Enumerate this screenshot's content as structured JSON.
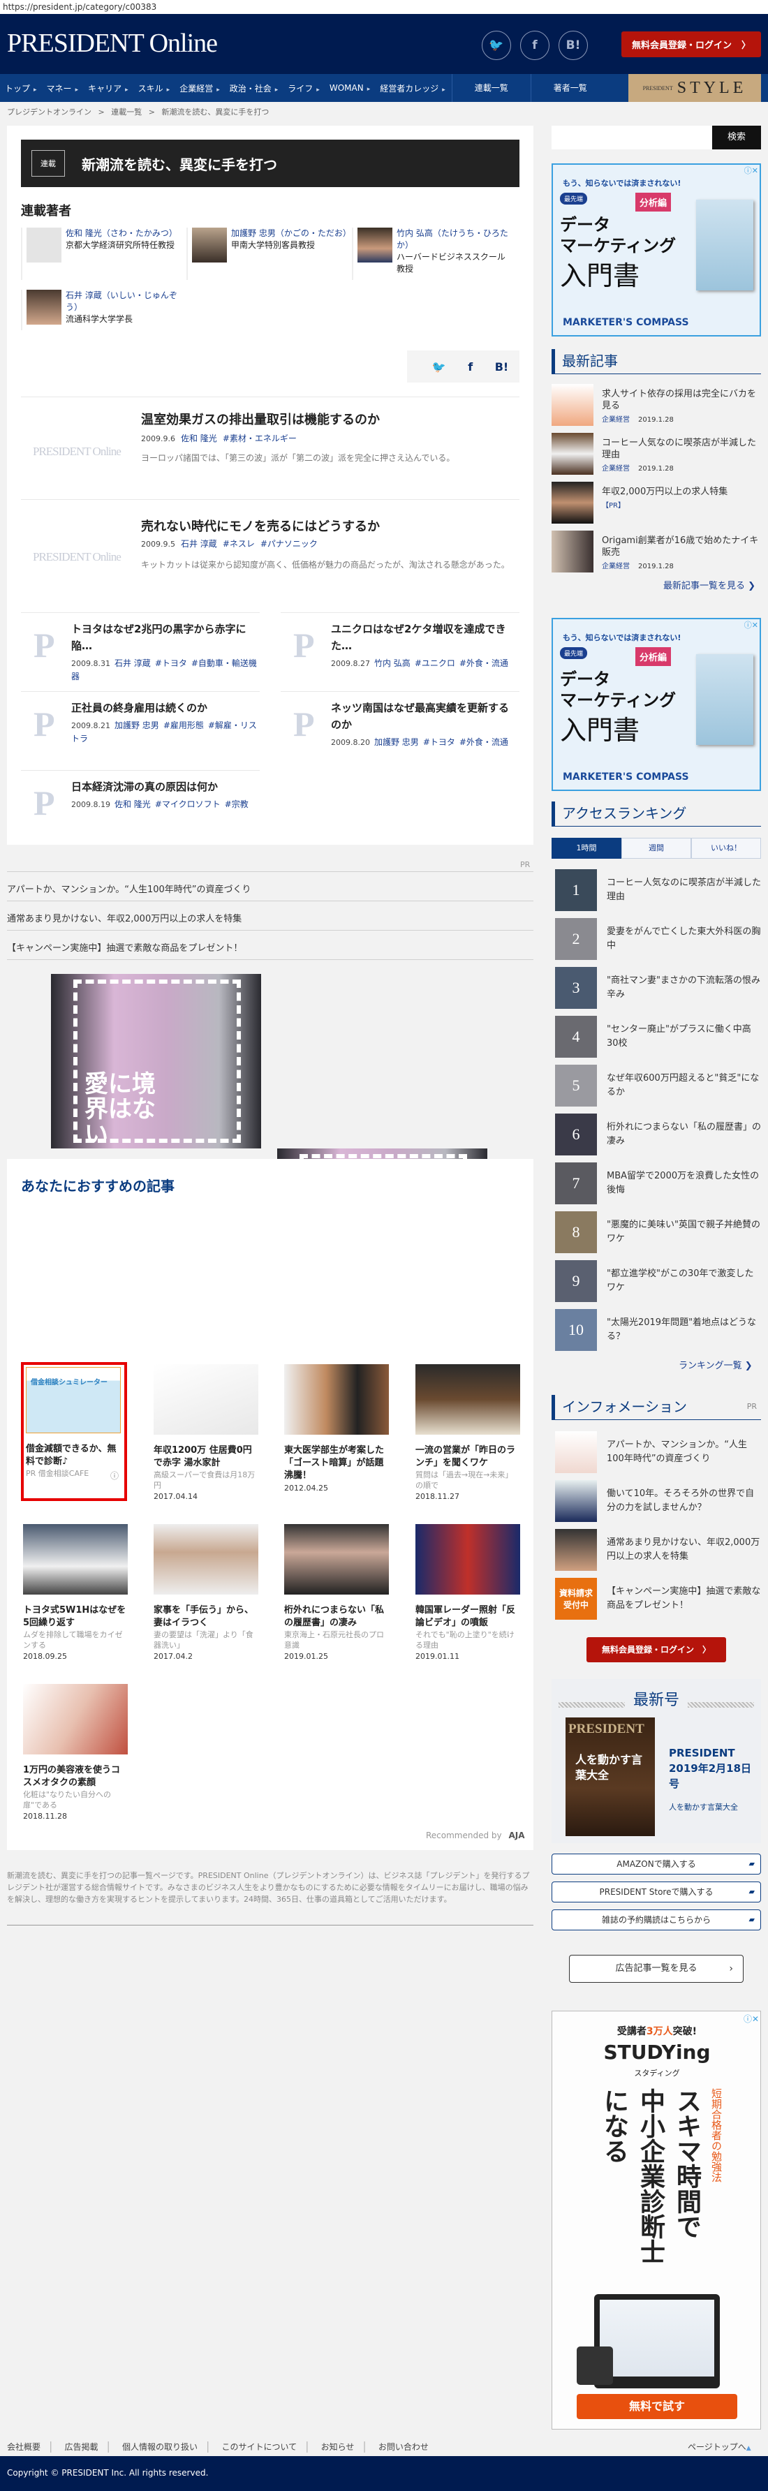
{
  "url": "https://president.jp/category/c00383",
  "header": {
    "logo": "PRESIDENT Online",
    "social": [
      "twitter",
      "facebook",
      "hatena"
    ],
    "social_labels": {
      "twitter": "🐦",
      "facebook": "f",
      "hatena": "B!"
    },
    "login": "無料会員登録・ログイン",
    "login_arrow": "〉"
  },
  "nav": {
    "items": [
      "トップ",
      "マネー",
      "キャリア",
      "スキル",
      "企業経営",
      "政治・社会",
      "ライフ",
      "WOMAN",
      "経営者カレッジ"
    ],
    "series": "連載一覧",
    "authors": "著者一覧",
    "style_small": "PRESIDENT",
    "style_big": "STYLE"
  },
  "breadcrumb": [
    "プレジデントオンライン",
    "連載一覧",
    "新潮流を読む、異変に手を打つ"
  ],
  "breadcrumb_sep": ">",
  "series": {
    "tag": "連載",
    "title": "新潮流を読む、異変に手を打つ",
    "authors_heading": "連載著者",
    "authors": [
      {
        "name": "佐和 隆光（さわ・たかみつ）",
        "affil": "京都大学経済研究所特任教授"
      },
      {
        "name": "加護野 忠男（かごの・ただお）",
        "affil": "甲南大学特別客員教授"
      },
      {
        "name": "竹内 弘高（たけうち・ひろたか）",
        "affil": "ハーバードビジネススクール教授"
      },
      {
        "name": "石井 淳蔵（いしい・じゅんぞう）",
        "affil": "流通科学大学学長"
      }
    ]
  },
  "share": {
    "tw": "🐦",
    "fb": "f",
    "hb": "B!"
  },
  "placeholder_logo": "PRESIDENT Online",
  "placeholder_p": "P",
  "articles": [
    {
      "title": "温室効果ガスの排出量取引は機能するのか",
      "date": "2009.9.6",
      "author": "佐和 隆光",
      "tags": [
        "#素材・エネルギー"
      ],
      "desc": "ヨーロッパ諸国では、「第三の波」派が「第二の波」派を完全に押さえ込んでいる。"
    },
    {
      "title": "売れない時代にモノを売るにはどうするか",
      "date": "2009.9.5",
      "author": "石井 淳蔵",
      "tags": [
        "#ネスレ",
        "#パナソニック"
      ],
      "desc": "キットカットは従来から認知度が高く、低価格が魅力の商品だったが、淘汰される懸念があった。"
    }
  ],
  "grid": [
    {
      "title": "トヨタはなぜ2兆円の黒字から赤字に陥…",
      "date": "2009.8.31",
      "author": "石井 淳蔵",
      "tags": [
        "#トヨタ",
        "#自動車・輸送機器"
      ]
    },
    {
      "title": "ユニクロはなぜ2ケタ増収を達成できた…",
      "date": "2009.8.27",
      "author": "竹内 弘高",
      "tags": [
        "#ユニクロ",
        "#外食・流通"
      ]
    },
    {
      "title": "正社員の終身雇用は続くのか",
      "date": "2009.8.21",
      "author": "加護野 忠男",
      "tags": [
        "#雇用形態",
        "#解雇・リストラ"
      ]
    },
    {
      "title": "ネッツ南国はなぜ最高実績を更新するのか",
      "date": "2009.8.20",
      "author": "加護野 忠男",
      "tags": [
        "#トヨタ",
        "#外食・流通"
      ]
    },
    {
      "title": "日本経済沈滞の真の原因は何か",
      "date": "2009.8.19",
      "author": "佐和 隆光",
      "tags": [
        "#マイクロソフト",
        "#宗教"
      ]
    }
  ],
  "pr": {
    "label": "PR",
    "links": [
      "アパートか、マンションか。“人生100年時代”の資産づくり",
      "通常あまり見かけない、年収2,000万円以上の求人を特集",
      "【キャンペーン実施中】抽選で素敵な商品をプレゼント！"
    ]
  },
  "banner": {
    "text": "愛に境界はない"
  },
  "recommend": {
    "heading": "あなたにおすすめの記事",
    "footer": "Recommended by",
    "footer_logo": "AJA",
    "items": [
      {
        "title": "借金減額できるか、無料で診断♪",
        "sub": "PR 借金相談CAFE",
        "date": "",
        "ad": true,
        "ad_img": "借金相談シュミレーター"
      },
      {
        "title": "年収1200万 住居費0円で赤字 湯水家計",
        "sub": "高級スーパーで食費は月18万円",
        "date": "2017.04.14"
      },
      {
        "title": "東大医学部生が考案した「ゴースト暗算」が話題沸騰！",
        "sub": "",
        "date": "2012.04.25"
      },
      {
        "title": "一流の営業が「昨日のランチ」を聞くワケ",
        "sub": "質問は「過去→現在→未来」の順で",
        "date": "2018.11.27"
      },
      {
        "title": "トヨタ式5W1Hはなぜを5回繰り返す",
        "sub": "ムダを排除して職場をカイゼンする",
        "date": "2018.09.25"
      },
      {
        "title": "家事を「手伝う」から、妻はイラつく",
        "sub": "妻の要望は「洗濯」より「食器洗い」",
        "date": "2017.04.2"
      },
      {
        "title": "桁外れにつまらない「私の履歴書」の凄み",
        "sub": "東京海上・石原元社長のプロ意識",
        "date": "2019.01.25"
      },
      {
        "title": "韓国軍レーダー照射「反論ビデオ」の噴飯",
        "sub": "それでも\"恥の上塗り\"を続ける理由",
        "date": "2019.01.11"
      },
      {
        "title": "1万円の美容液を使うコスメオタクの素顔",
        "sub": "化粧は\"なりたい自分への扉\"である",
        "date": "2018.11.28"
      }
    ]
  },
  "footer_desc": "新潮流を読む、異変に手を打つの記事一覧ページです。PRESIDENT Online（プレジデントオンライン）は、ビジネス誌「プレジデント」を発行するプレジデント社が運営する総合情報サイトです。みなさまのビジネス人生をより豊かなものにするために必要な情報をタイムリーにお届けし、職場の悩みを解決し、理想的な働き方を実現するヒントを提示してまいります。24時間、365日、仕事の道具箱としてご活用いただけます。",
  "sidebar": {
    "search_button": "検索",
    "search_placeholder": "",
    "ad1": {
      "catch": "もう、知らないでは済まされない!",
      "badge": "最先端",
      "title1": "データ",
      "title2": "マーケティング",
      "title3": "入門書",
      "ribbon": "分析編",
      "brand": "MARKETER'S COMPASS"
    },
    "latest": {
      "heading": "最新記事",
      "more": "最新記事一覧を見る ❯",
      "items": [
        {
          "title": "求人サイト依存の採用は完全にバカを見る",
          "cat": "企業経営",
          "date": "2019.1.28"
        },
        {
          "title": "コーヒー人気なのに喫茶店が半減した理由",
          "cat": "企業経営",
          "date": "2019.1.28"
        },
        {
          "title": "年収2,000万円以上の求人特集",
          "cat": "【PR】",
          "date": ""
        },
        {
          "title": "Origami創業者が16歳で始めたナイキ販売",
          "cat": "企業経営",
          "date": "2019.1.28"
        }
      ]
    },
    "ranking": {
      "heading": "アクセスランキング",
      "tabs": [
        "1時間",
        "週間",
        "いいね！"
      ],
      "more": "ランキング一覧 ❯",
      "items": [
        {
          "rank": "1",
          "title": "コーヒー人気なのに喫茶店が半減した理由"
        },
        {
          "rank": "2",
          "title": "愛妻をがんで亡くした東大外科医の胸中"
        },
        {
          "rank": "3",
          "title": "\"商社マン妻\"まさかの下流転落の恨み辛み"
        },
        {
          "rank": "4",
          "title": "\"センター廃止\"がプラスに働く中高30校"
        },
        {
          "rank": "5",
          "title": "なぜ年収600万円超えると\"貧乏\"になるか"
        },
        {
          "rank": "6",
          "title": "桁外れにつまらない「私の履歴書」の凄み"
        },
        {
          "rank": "7",
          "title": "MBA留学で2000万を浪費した女性の後悔"
        },
        {
          "rank": "8",
          "title": "\"悪魔的に美味い\"英国で親子丼絶賛のワケ"
        },
        {
          "rank": "9",
          "title": "\"都立進学校\"がこの30年で激変したワケ"
        },
        {
          "rank": "10",
          "title": "\"太陽光2019年問題\"着地点はどうなる？"
        }
      ]
    },
    "info": {
      "heading": "インフォメーション",
      "pr": "PR",
      "items": [
        "アパートか、マンションか。“人生100年時代”の資産づくり",
        "働いて10年。そろそろ外の世界で自分の力を試しませんか？",
        "通常あまり見かけない、年収2,000万円以上の求人を特集",
        "【キャンペーン実施中】抽選で素敵な商品をプレゼント！"
      ],
      "badge": "資料請求受付中",
      "login": "無料会員登録・ログイン　〉"
    },
    "issue": {
      "heading": "最新号",
      "title": "PRESIDENT 2019年2月18日号",
      "subtitle": "人を動かす言葉大全",
      "cover_logo": "PRESIDENT",
      "cover_text": "人を動かす言葉大全"
    },
    "buy": [
      "AMAZONで購入する",
      "PRESIDENT Storeで購入する",
      "雑誌の予約購読はこちらから"
    ],
    "ad_list": "広告記事一覧を見る",
    "ad2": {
      "catch1": "受講者",
      "catch2": "3万人",
      "catch3": "突破!",
      "brand": "STUDYing",
      "brand_kana": "スタディング",
      "red": "短期合格者の勉強法",
      "main1": "スキマ時間で",
      "main2": "中小企業診断士",
      "main3": "になる",
      "cta": "無料で試す"
    }
  },
  "footer": {
    "links": [
      "会社概要",
      "広告掲載",
      "個人情報の取り扱い",
      "このサイトについて",
      "お知らせ",
      "お問い合わせ"
    ],
    "pagetop": "ページトップへ",
    "copyright": "Copyright © PRESIDENT Inc. All rights reserved."
  },
  "colors": {
    "navy": "#001b50",
    "nav": "#0b3c80",
    "red": "#b5140b",
    "link": "#1a3f8f"
  }
}
